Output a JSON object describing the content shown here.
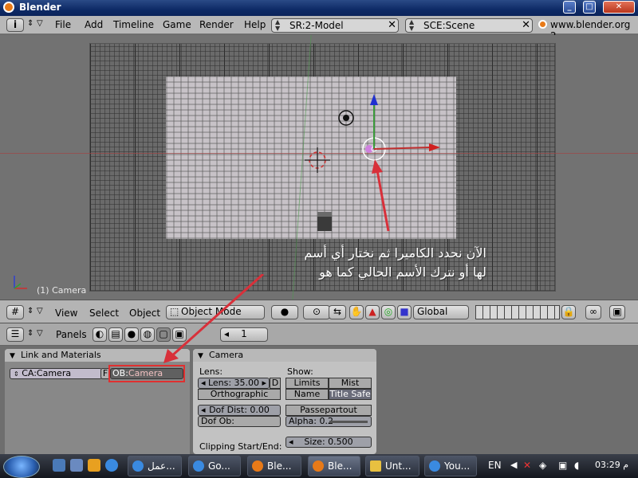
{
  "window": {
    "title": "Blender"
  },
  "top_header": {
    "menu": [
      "File",
      "Add",
      "Timeline",
      "Game",
      "Render",
      "Help"
    ],
    "screen_field": "SR:2-Model",
    "scene_field": "SCE:Scene",
    "website": "www.blender.org 2"
  },
  "viewport": {
    "object_label": "(1) Camera",
    "annotation_line1": "الآن نحدد الكاميرا ثم نختار أي أسم",
    "annotation_line2": "لها أو نترك الأسم الحالي كما هو"
  },
  "view_header": {
    "menu": [
      "View",
      "Select",
      "Object"
    ],
    "mode": "Object Mode",
    "orientation": "Global"
  },
  "panels_header": {
    "label": "Panels",
    "frame": "1"
  },
  "link_panel": {
    "title": "Link and Materials",
    "ca_field": "CA:Camera",
    "f_button": "F",
    "ob_prefix": "OB:",
    "ob_value": "Camera"
  },
  "camera_panel": {
    "title": "Camera",
    "lens_label": "Lens:",
    "lens_field": "Lens: 35.00",
    "d_button": "D",
    "ortho_button": "Orthographic",
    "dof_dist": "Dof Dist: 0.00",
    "dof_ob": "Dof Ob:",
    "clipping_label": "Clipping Start/End:",
    "show_label": "Show:",
    "limits_button": "Limits",
    "mist_button": "Mist",
    "name_button": "Name",
    "titlesafe_button": "Title Safe",
    "passepartout_button": "Passepartout",
    "alpha": "Alpha: 0.2",
    "size": "Size: 0.500"
  },
  "taskbar": {
    "tasks": [
      "عمل...",
      "Go...",
      "Ble...",
      "Ble...",
      "Unt...",
      "You..."
    ],
    "lang": "EN",
    "time": "03:29 م"
  },
  "colors": {
    "highlight_box": "#e03030",
    "annotation_arrow": "#d8303a",
    "ob_text": "#f0c0c0"
  }
}
